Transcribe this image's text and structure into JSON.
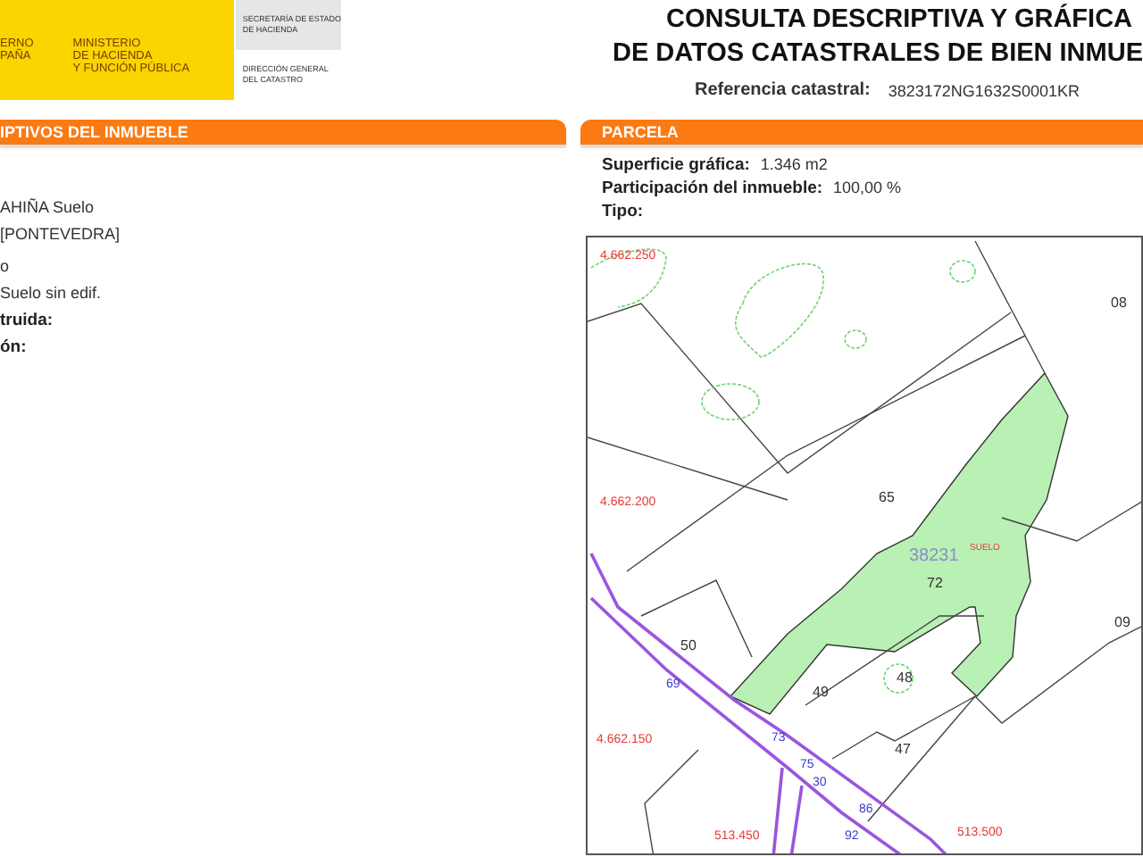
{
  "header": {
    "government_lines": [
      "ERNO",
      "PAÑA"
    ],
    "ministry_lines": [
      "MINISTERIO",
      "DE HACIENDA",
      "Y FUNCIÓN PÚBLICA"
    ],
    "secretariat_lines": [
      "SECRETARÍA DE ESTADO",
      "DE HACIENDA"
    ],
    "directorate_lines": [
      "DIRECCIÓN GENERAL",
      "DEL CATASTRO"
    ],
    "title_lines": [
      "CONSULTA DESCRIPTIVA Y GRÁFICA",
      "DE DATOS CATASTRALES DE BIEN INMUE"
    ],
    "reference_label": "Referencia catastral:",
    "reference_value": "3823172NG1632S0001KR"
  },
  "property_panel": {
    "heading": "IPTIVOS DEL INMUEBLE",
    "fields": [
      {
        "value": "AHIÑA  Suelo"
      },
      {
        "value": "[PONTEVEDRA]"
      },
      {
        "value": "o"
      },
      {
        "value": "Suelo sin edif."
      },
      {
        "label": "truida:"
      },
      {
        "label": "ón:"
      }
    ]
  },
  "parcel_panel": {
    "heading": "PARCELA",
    "fields": [
      {
        "label": "Superficie gráfica:",
        "value": "1.346 m2"
      },
      {
        "label": "Participación del inmueble:",
        "value": "100,00 %"
      },
      {
        "label": "Tipo:"
      }
    ],
    "map_labels": [
      {
        "text": "4.662.250",
        "kind": "coord"
      },
      {
        "text": "08",
        "kind": "parcel"
      },
      {
        "text": "65",
        "kind": "parcel"
      },
      {
        "text": "4.662.200",
        "kind": "coord"
      },
      {
        "text": "38231",
        "kind": "block"
      },
      {
        "text": "SUELO",
        "kind": "use"
      },
      {
        "text": "72",
        "kind": "parcel"
      },
      {
        "text": "09",
        "kind": "parcel"
      },
      {
        "text": "50",
        "kind": "parcel"
      },
      {
        "text": "49",
        "kind": "parcel"
      },
      {
        "text": "48",
        "kind": "parcel"
      },
      {
        "text": "47",
        "kind": "parcel"
      },
      {
        "text": "4.662.150",
        "kind": "coord"
      },
      {
        "text": "513.450",
        "kind": "coord"
      },
      {
        "text": "513.500",
        "kind": "coord"
      },
      {
        "text": "69",
        "kind": "road"
      },
      {
        "text": "73",
        "kind": "road"
      },
      {
        "text": "75",
        "kind": "road"
      },
      {
        "text": "30",
        "kind": "road"
      },
      {
        "text": "86",
        "kind": "road"
      },
      {
        "text": "92",
        "kind": "road"
      }
    ]
  }
}
